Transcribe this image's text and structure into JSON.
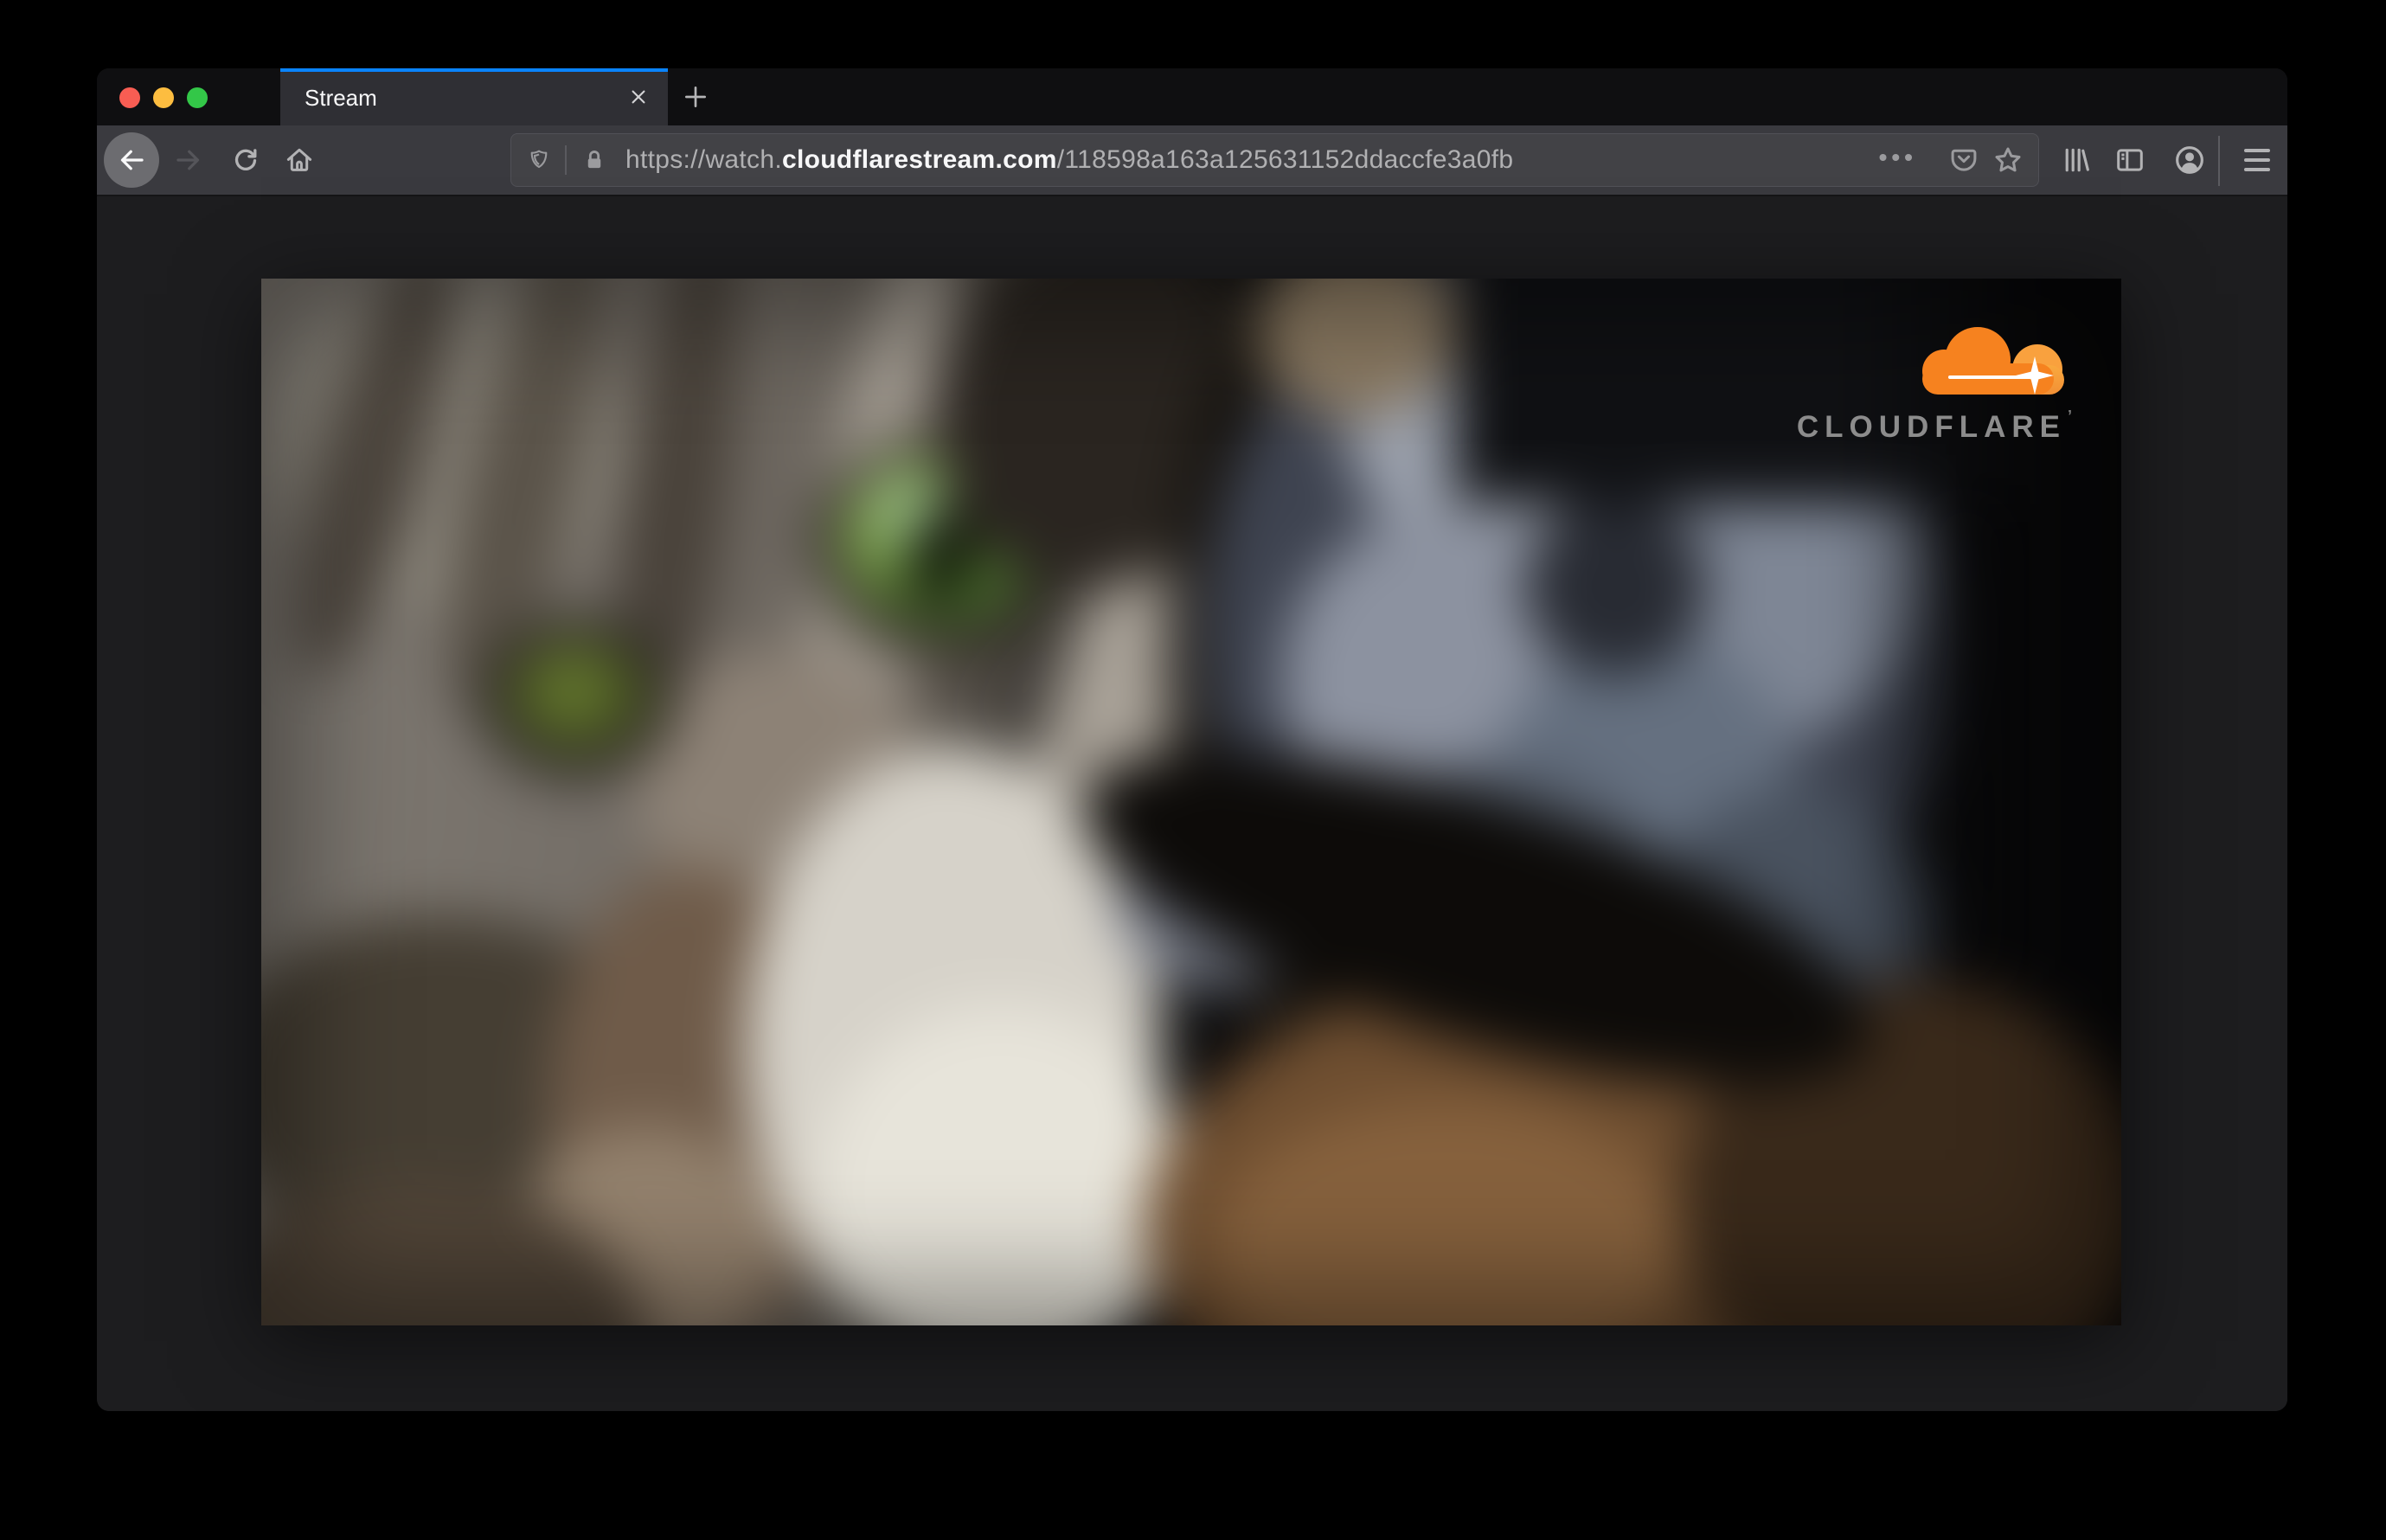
{
  "browser": {
    "tab": {
      "title": "Stream"
    },
    "address": {
      "scheme_host_prefix": "https://watch.",
      "domain_highlight": "cloudflarestream.com",
      "path": "/118598a163a125631152ddaccfe3a0fb"
    }
  },
  "video": {
    "brand_wordmark": "CLOUDFLARE",
    "brand_tick": "’"
  },
  "icons": {
    "page_actions": "•••",
    "back": "left-arrow",
    "forward": "right-arrow",
    "reload": "refresh-circular-arrow",
    "home": "house",
    "tracking_protection": "shield",
    "connection_secure": "lock",
    "save_to_pocket": "pocket",
    "bookmark": "star-outline",
    "library": "books",
    "sidebars": "split-rectangle",
    "account": "person-circle",
    "menu": "hamburger",
    "tab_close": "x",
    "new_tab": "plus",
    "video_brand": "cloudflare-cloud"
  },
  "colors": {
    "accent_blue": "#0a84ff",
    "notification_badge_blue": "#1ca3fd",
    "cloudflare_orange": "#f6821f",
    "cloudflare_orange_light": "#f9a13e",
    "mac_close_red": "#f85d53",
    "mac_minimize_yellow": "#fdbd40",
    "mac_zoom_green": "#33c748"
  }
}
